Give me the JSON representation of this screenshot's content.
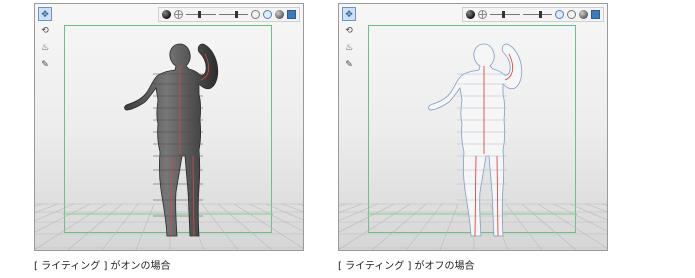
{
  "panels": [
    {
      "caption": "[ ライティング ] がオンの場合",
      "lighting": "on",
      "figure_fill": "#5a5a5a",
      "figure_stroke": "#2a2a2a",
      "center_line": "#d04a4a"
    },
    {
      "caption": "[ ライティング ] がオフの場合",
      "lighting": "off",
      "figure_fill": "#f6f6f6",
      "figure_stroke": "#7f9dc4",
      "center_line": "#e03030"
    }
  ],
  "left_tools": [
    {
      "name": "move-tool-icon",
      "glyph": "✥"
    },
    {
      "name": "rotate-tool-icon",
      "glyph": "⟲"
    },
    {
      "name": "pose-tool-icon",
      "glyph": "♨"
    },
    {
      "name": "pen-tool-icon",
      "glyph": "✎"
    }
  ],
  "toolbar_icons": [
    "lighting-sphere-icon",
    "light-direction-icon",
    "slider-1",
    "slider-2",
    "lighting-on-icon",
    "lighting-toggle-icon",
    "shading-icon",
    "settings-icon"
  ],
  "colors": {
    "guide_frame": "#66c286",
    "floor_grid": "#b9b9b9",
    "floor_green_line": "#7cd08e",
    "accent": "#3f79bd"
  }
}
